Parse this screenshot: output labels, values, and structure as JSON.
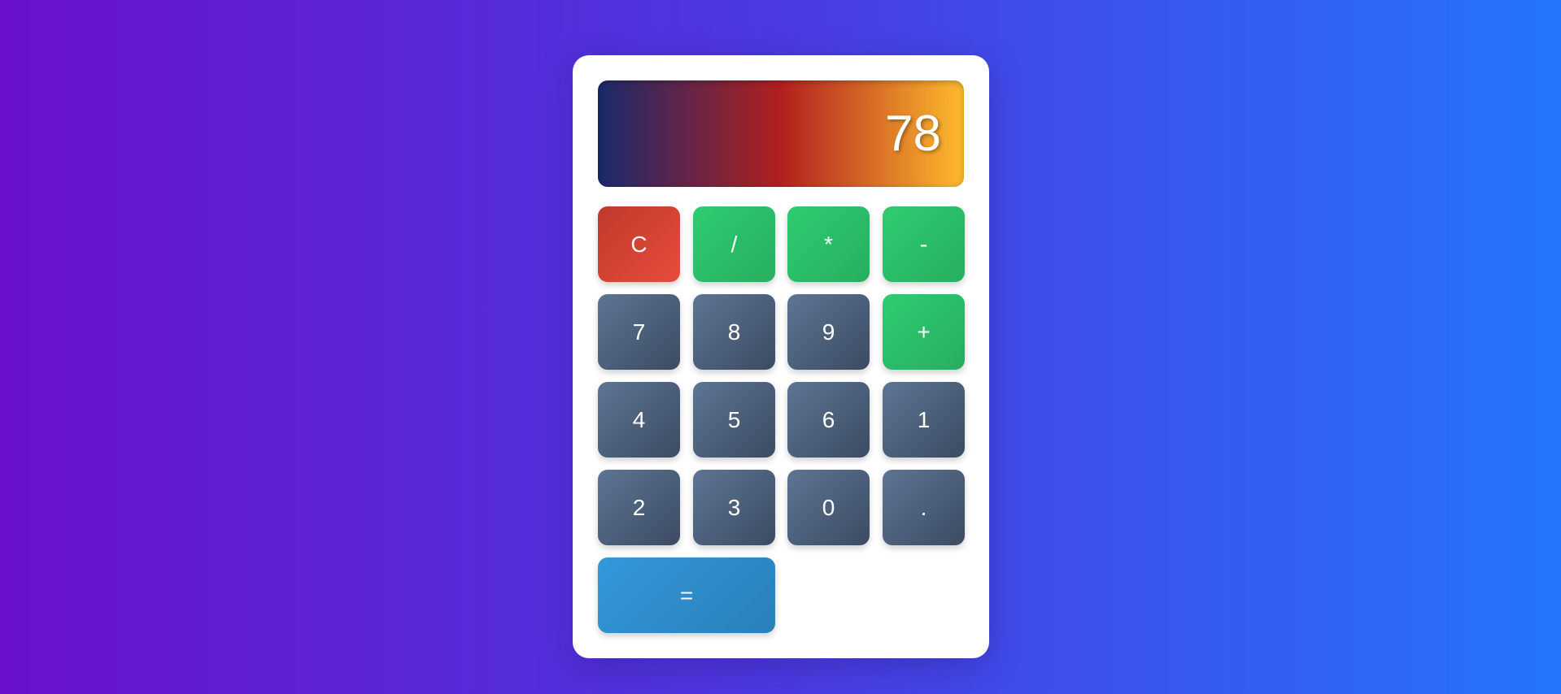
{
  "display": {
    "value": "78"
  },
  "buttons": {
    "clear": "C",
    "divide": "/",
    "multiply": "*",
    "subtract": "-",
    "add": "+",
    "seven": "7",
    "eight": "8",
    "nine": "9",
    "four": "4",
    "five": "5",
    "six": "6",
    "one": "1",
    "two": "2",
    "three": "3",
    "zero": "0",
    "decimal": ".",
    "equals": "="
  },
  "colors": {
    "background_start": "#6a11cb",
    "background_end": "#2575fc",
    "number_button": "#4a5d78",
    "operator_button": "#2ecc71",
    "clear_button": "#e74c3c",
    "equals_button": "#3498db",
    "display_gradient": [
      "#1a2a6c",
      "#b21f1f",
      "#fdbb2d"
    ]
  }
}
